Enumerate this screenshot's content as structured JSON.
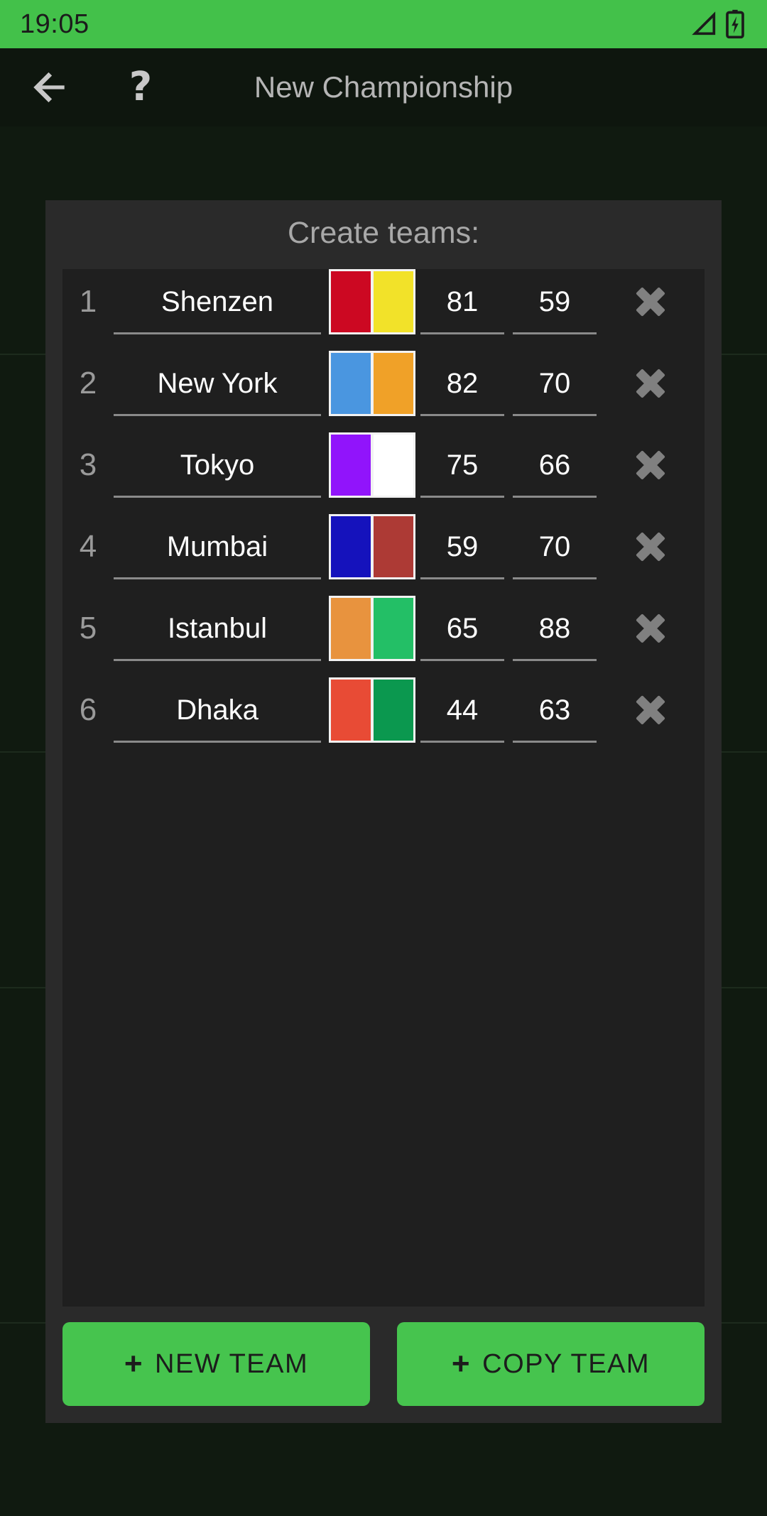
{
  "status_bar": {
    "time": "19:05",
    "signal_icon": "signal-triangle-icon",
    "battery_icon": "battery-charging-icon",
    "background_color": "#43c14a"
  },
  "toolbar": {
    "back_icon": "back-arrow-icon",
    "help_icon": "question-mark-icon",
    "help_label": "?",
    "title": "New Championship"
  },
  "card": {
    "title": "Create teams:",
    "columns": [
      "index",
      "name",
      "colors",
      "attack",
      "defense",
      "delete"
    ],
    "teams": [
      {
        "index": "1",
        "name": "Shenzen",
        "color1": "#cc0822",
        "color2": "#f2e229",
        "num1": "81",
        "num2": "59",
        "delete_icon": "close-x-icon"
      },
      {
        "index": "2",
        "name": "New York",
        "color1": "#4a96e0",
        "color2": "#f0a128",
        "num1": "82",
        "num2": "70",
        "delete_icon": "close-x-icon"
      },
      {
        "index": "3",
        "name": "Tokyo",
        "color1": "#9114fb",
        "color2": "#ffffff",
        "num1": "75",
        "num2": "66",
        "delete_icon": "close-x-icon"
      },
      {
        "index": "4",
        "name": "Mumbai",
        "color1": "#1512bc",
        "color2": "#ad3a35",
        "num1": "59",
        "num2": "70",
        "delete_icon": "close-x-icon"
      },
      {
        "index": "5",
        "name": "Istanbul",
        "color1": "#e8933e",
        "color2": "#23bf66",
        "num1": "65",
        "num2": "88",
        "delete_icon": "close-x-icon"
      },
      {
        "index": "6",
        "name": "Dhaka",
        "color1": "#e84b35",
        "color2": "#0b984f",
        "num1": "44",
        "num2": "63",
        "delete_icon": "close-x-icon"
      }
    ]
  },
  "footer": {
    "new_team": {
      "label": "NEW TEAM",
      "plus": "+",
      "icon": "plus-icon"
    },
    "copy_team": {
      "label": "COPY TEAM",
      "plus": "+",
      "icon": "plus-icon"
    },
    "button_color": "#46c44e"
  }
}
